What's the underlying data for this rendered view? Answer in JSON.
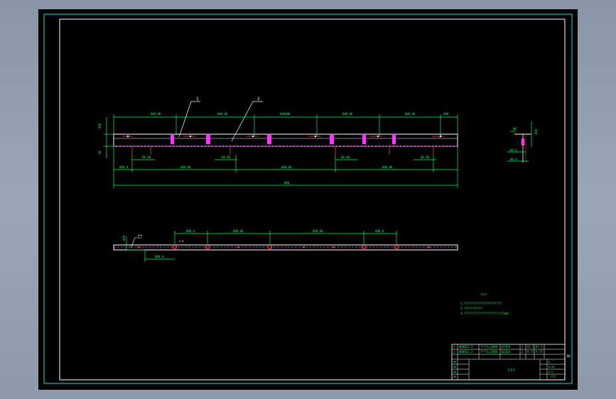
{
  "drawing": {
    "background": "#000000",
    "frame_color": "#00e5e5",
    "callout_1": "1",
    "callout_2": "2",
    "dim_total": "888",
    "notes_title": "???",
    "note_lines": [
      "1.??????????????????????",
      "2.???????????",
      "3.???????????????????????2mm."
    ],
    "title_block": {
      "part_rows": [
        [
          "2",
          "WGKB12-3",
          "????L=5480",
          "Q235A",
          "1",
          "67.5",
          "67.5"
        ],
        [
          "1",
          "WGKB12-2",
          "????L=5480",
          "Q235A",
          "2",
          "9.75",
          "9.75"
        ]
      ],
      "drawing_name": "???",
      "sheet_text": "??1"
    }
  },
  "colors": {
    "cyan": "#00e5e5",
    "green": "#00ff66",
    "white": "#ffffff",
    "magenta": "#ff33ff",
    "red": "#ff3030",
    "yellow": "#ffff00"
  }
}
